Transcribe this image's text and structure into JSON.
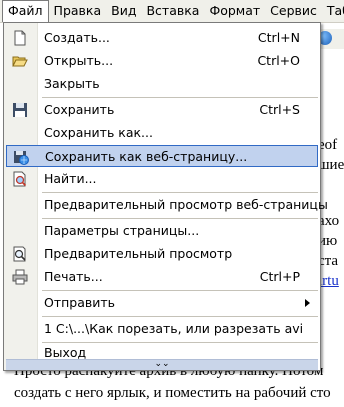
{
  "menubar": {
    "items": [
      {
        "label": "Файл"
      },
      {
        "label": "Правка"
      },
      {
        "label": "Вид"
      },
      {
        "label": "Вставка"
      },
      {
        "label": "Формат"
      },
      {
        "label": "Сервис"
      },
      {
        "label": "Таб"
      }
    ]
  },
  "menu": {
    "items": [
      {
        "label": "Создать...",
        "shortcut": "Ctrl+N",
        "icon": "new-document-icon"
      },
      {
        "label": "Открыть...",
        "shortcut": "Ctrl+O",
        "icon": "open-folder-icon"
      },
      {
        "label": "Закрыть",
        "shortcut": "",
        "icon": ""
      },
      {
        "label": "Сохранить",
        "shortcut": "Ctrl+S",
        "icon": "save-disk-icon"
      },
      {
        "label": "Сохранить как...",
        "shortcut": "",
        "icon": ""
      },
      {
        "label": "Сохранить как веб-страницу...",
        "shortcut": "",
        "icon": "save-as-web-page-icon",
        "highlighted": true
      },
      {
        "label": "Найти...",
        "shortcut": "",
        "icon": "find-file-icon"
      },
      {
        "label": "Предварительный просмотр веб-страницы",
        "shortcut": "",
        "icon": ""
      },
      {
        "label": "Параметры страницы...",
        "shortcut": "",
        "icon": ""
      },
      {
        "label": "Предварительный просмотр",
        "shortcut": "",
        "icon": "print-preview-icon"
      },
      {
        "label": "Печать...",
        "shortcut": "Ctrl+P",
        "icon": "printer-icon"
      },
      {
        "label": "Отправить",
        "shortcut": "",
        "icon": "",
        "submenu": true
      },
      {
        "label": "1 C:\\...\\Как порезать, или разрезать avi",
        "shortcut": "",
        "icon": ""
      },
      {
        "label": "Выход",
        "shortcut": "",
        "icon": ""
      }
    ],
    "expand_glyph": "⌄⌄"
  },
  "document": {
    "lines": [
      {
        "text": "eof"
      },
      {
        "text": "шие"
      },
      {
        "text": "ахо"
      },
      {
        "text": "ию"
      },
      {
        "text": "ста"
      },
      {
        "text": "irtu",
        "link": true
      },
      {
        "text": "Просто распакуйте архив в любую папку. Потом"
      },
      {
        "text": "создать с него ярлык, и поместить на рабочий сто"
      }
    ]
  },
  "colors": {
    "highlight_bg": "#c1d2ee",
    "highlight_border": "#316ac5",
    "menu_rail": "#f1f1ec",
    "link": "#1a33cc"
  }
}
